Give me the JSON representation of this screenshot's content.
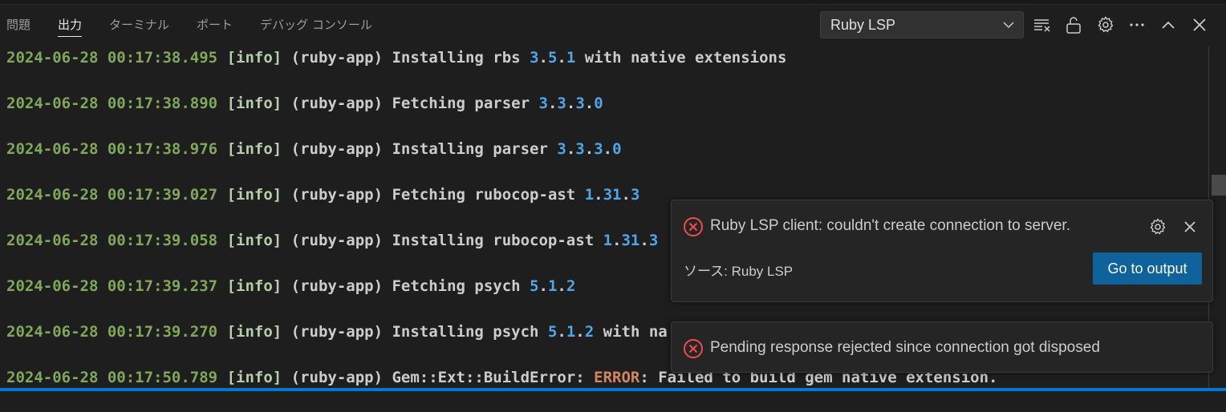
{
  "panel_tabs": [
    {
      "label": "問題"
    },
    {
      "label": "出力"
    },
    {
      "label": "ターミナル"
    },
    {
      "label": "ポート"
    },
    {
      "label": "デバッグ コンソール"
    }
  ],
  "active_tab": "出力",
  "channel_select": {
    "value": "Ruby LSP"
  },
  "toolbar_icons": [
    "clear-output-icon",
    "lock-scroll-icon",
    "gear-icon",
    "more-actions-icon",
    "maximize-panel-icon",
    "close-panel-icon"
  ],
  "log_lines": [
    {
      "ts": "2024-06-28 00:17:38.495",
      "level": "[info]",
      "pre": " (ruby-app) Installing rbs ",
      "ver": [
        "3",
        "5",
        "1"
      ],
      "post": " with native extensions"
    },
    {
      "ts": "2024-06-28 00:17:38.890",
      "level": "[info]",
      "pre": " (ruby-app) Fetching parser ",
      "ver": [
        "3",
        "3",
        "3",
        "0"
      ],
      "post": ""
    },
    {
      "ts": "2024-06-28 00:17:38.976",
      "level": "[info]",
      "pre": " (ruby-app) Installing parser ",
      "ver": [
        "3",
        "3",
        "3",
        "0"
      ],
      "post": ""
    },
    {
      "ts": "2024-06-28 00:17:39.027",
      "level": "[info]",
      "pre": " (ruby-app) Fetching rubocop-ast ",
      "ver": [
        "1",
        "31",
        "3"
      ],
      "post": ""
    },
    {
      "ts": "2024-06-28 00:17:39.058",
      "level": "[info]",
      "pre": " (ruby-app) Installing rubocop-ast ",
      "ver": [
        "1",
        "31",
        "3"
      ],
      "post": ""
    },
    {
      "ts": "2024-06-28 00:17:39.237",
      "level": "[info]",
      "pre": " (ruby-app) Fetching psych ",
      "ver": [
        "5",
        "1",
        "2"
      ],
      "post": ""
    },
    {
      "ts": "2024-06-28 00:17:39.270",
      "level": "[info]",
      "pre": " (ruby-app) Installing psych ",
      "ver": [
        "5",
        "1",
        "2"
      ],
      "post": " with na"
    },
    {
      "ts": "2024-06-28 00:17:50.789",
      "level": "[info]",
      "pre": " (ruby-app) Gem::Ext::BuildError: ",
      "err": "ERROR",
      "post": ": Failed to build gem native extension."
    }
  ],
  "notification_1": {
    "message": "Ruby LSP client: couldn't create connection to server.",
    "source": "ソース: Ruby LSP",
    "button": "Go to output"
  },
  "notification_2": {
    "message": "Pending response rejected since connection got disposed"
  },
  "colors": {
    "background": "#1e1e1e",
    "timestamp": "#7fa85b",
    "number": "#4fa6e8",
    "error_word": "#d18560",
    "button": "#0e639c",
    "error_icon": "#f14c4c",
    "status_bar": "#0078d4"
  }
}
